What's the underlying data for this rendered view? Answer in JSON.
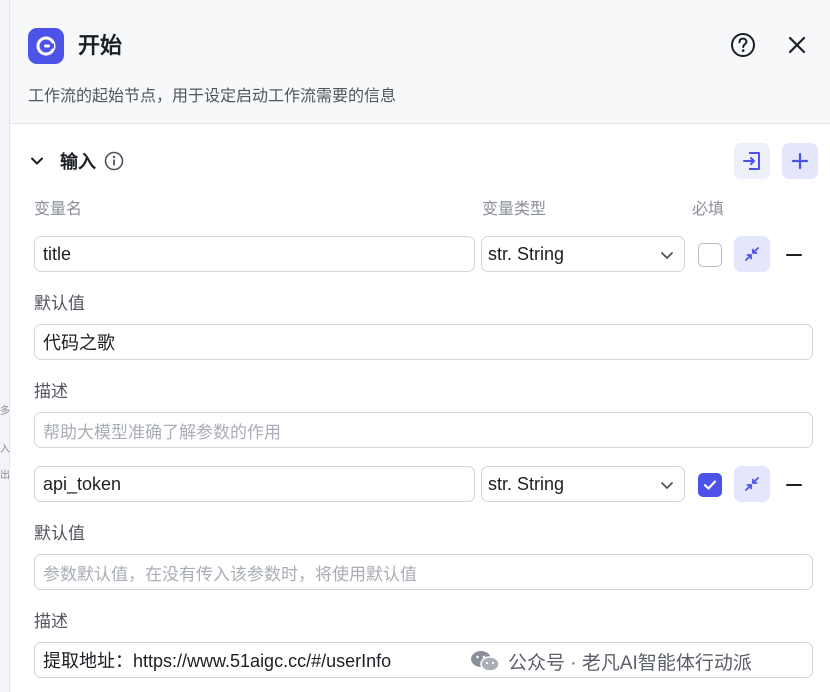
{
  "left_strip": {
    "fragments": [
      "多",
      "入",
      "出"
    ]
  },
  "header": {
    "title": "开始",
    "description": "工作流的起始节点，用于设定启动工作流需要的信息",
    "node_icon": "start-node-icon",
    "help_icon": "question-circle-icon",
    "close_icon": "close-icon",
    "accent_color": "#4d53e8"
  },
  "input_section": {
    "title": "输入",
    "columns": {
      "name": "变量名",
      "type": "变量类型",
      "required": "必填"
    },
    "params": [
      {
        "name": "title",
        "type": "str. String",
        "required": false,
        "default_label": "默认值",
        "default_value": "代码之歌",
        "default_placeholder": "",
        "desc_label": "描述",
        "desc_value": "",
        "desc_placeholder": "帮助大模型准确了解参数的作用"
      },
      {
        "name": "api_token",
        "type": "str. String",
        "required": true,
        "default_label": "默认值",
        "default_value": "",
        "default_placeholder": "参数默认值，在没有传入该参数时，将使用默认值",
        "desc_label": "描述",
        "desc_value": "提取地址：https://www.51aigc.cc/#/userInfo",
        "desc_placeholder": ""
      }
    ]
  },
  "watermark": {
    "text": "公众号 · 老凡AI智能体行动派"
  }
}
